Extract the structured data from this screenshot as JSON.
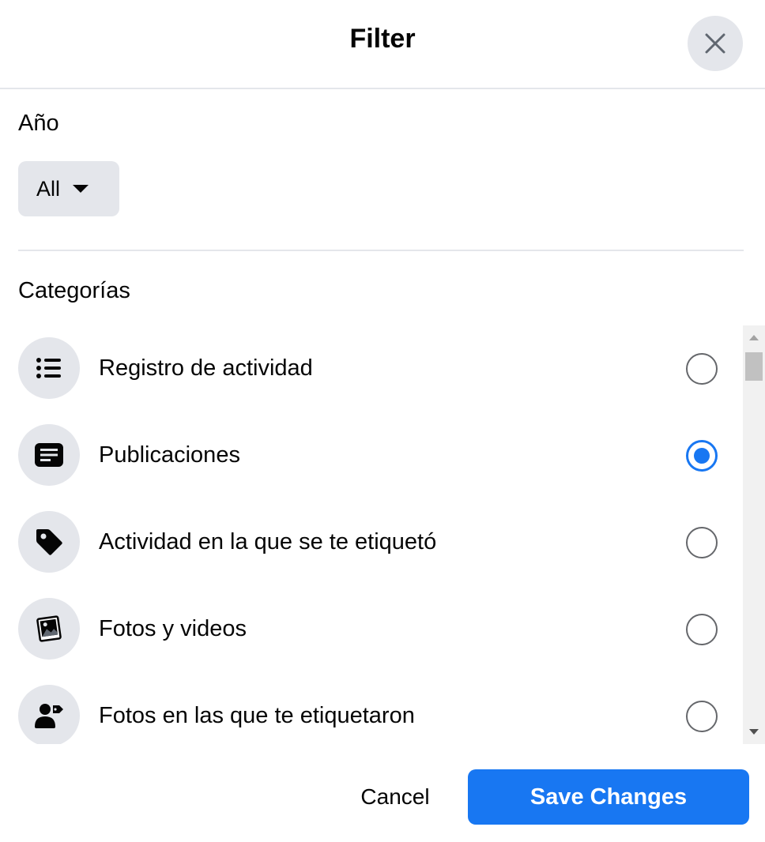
{
  "dialog": {
    "title": "Filter",
    "close_icon": "close-icon"
  },
  "year": {
    "label": "Año",
    "selected": "All",
    "dropdown_icon": "caret-down-icon"
  },
  "categories": {
    "label": "Categorías",
    "items": [
      {
        "label": "Registro de actividad",
        "icon": "list-icon",
        "selected": false
      },
      {
        "label": "Publicaciones",
        "icon": "post-icon",
        "selected": true
      },
      {
        "label": "Actividad en la que se te etiquetó",
        "icon": "tag-icon",
        "selected": false
      },
      {
        "label": "Fotos y videos",
        "icon": "photo-icon",
        "selected": false
      },
      {
        "label": "Fotos en las que te etiquetaron",
        "icon": "tagged-person-icon",
        "selected": false
      }
    ]
  },
  "footer": {
    "cancel_label": "Cancel",
    "save_label": "Save Changes"
  },
  "colors": {
    "accent": "#1877f2",
    "icon_bg": "#e4e6eb",
    "text": "#050505"
  }
}
